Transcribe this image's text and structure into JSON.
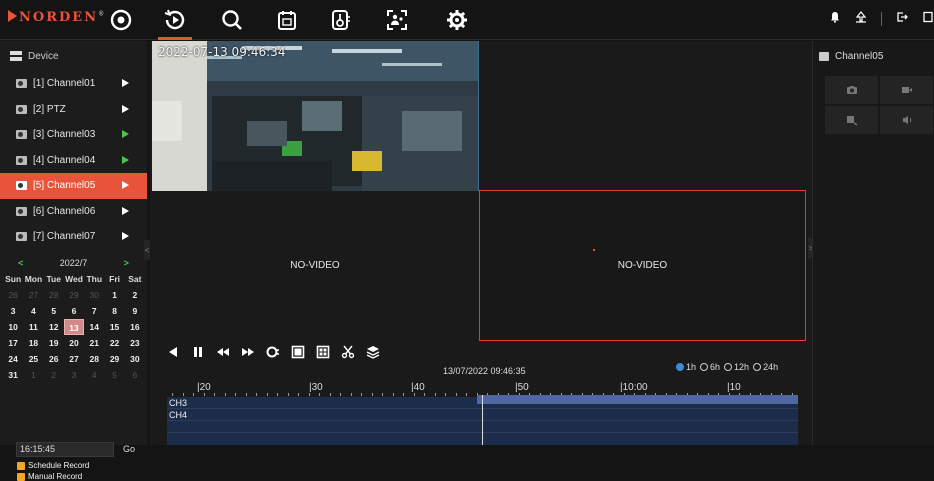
{
  "brand": {
    "name": "NORDEN",
    "reg": "®",
    "accent": "#e8533a"
  },
  "nav": [
    {
      "icon": "live-view-icon"
    },
    {
      "icon": "playback-icon",
      "active": true
    },
    {
      "icon": "search-icon"
    },
    {
      "icon": "calendar-icon"
    },
    {
      "icon": "thermometer-icon"
    },
    {
      "icon": "face-scan-icon"
    },
    {
      "icon": "gear-icon"
    }
  ],
  "device": {
    "title": "Device",
    "channels": [
      {
        "label": "[1] Channel01",
        "play": "white"
      },
      {
        "label": "[2] PTZ",
        "play": "white"
      },
      {
        "label": "[3] Channel03",
        "play": "green"
      },
      {
        "label": "[4] Channel04",
        "play": "green"
      },
      {
        "label": "[5] Channel05",
        "play": "white",
        "selected": true
      },
      {
        "label": "[6] Channel06",
        "play": "white"
      },
      {
        "label": "[7] Channel07",
        "play": "white"
      }
    ]
  },
  "calendar": {
    "prev": "<",
    "next": ">",
    "month": "2022/7",
    "weekdays": [
      "Sun",
      "Mon",
      "Tue",
      "Wed",
      "Thu",
      "Fri",
      "Sat"
    ],
    "weeks": [
      [
        "26",
        "27",
        "28",
        "29",
        "30",
        "1",
        "2"
      ],
      [
        "3",
        "4",
        "5",
        "6",
        "7",
        "8",
        "9"
      ],
      [
        "10",
        "11",
        "12",
        "13",
        "14",
        "15",
        "16"
      ],
      [
        "17",
        "18",
        "19",
        "20",
        "21",
        "22",
        "23"
      ],
      [
        "24",
        "25",
        "26",
        "27",
        "28",
        "29",
        "30"
      ],
      [
        "31",
        "1",
        "2",
        "3",
        "4",
        "5",
        "6"
      ]
    ],
    "today": "13"
  },
  "goto": {
    "time": "16:15:45",
    "button": "Go"
  },
  "legend": [
    {
      "label": "Schedule Record",
      "color": "#f5a623"
    },
    {
      "label": "Manual Record",
      "color": "#f5a623"
    }
  ],
  "video": {
    "timestamp": "2022-07-13 09:46:34",
    "panes": [
      "NO-VIDEO",
      "NO-VIDEO"
    ]
  },
  "playback": {
    "time": "13/07/2022 09:46:35",
    "ranges": [
      {
        "label": "1h",
        "selected": true
      },
      {
        "label": "6h"
      },
      {
        "label": "12h"
      },
      {
        "label": "24h"
      }
    ]
  },
  "timeline": {
    "labels": [
      "|20",
      "|30",
      "|40",
      "|50",
      "|10:00",
      "|10"
    ],
    "rows": [
      "CH3",
      "CH4"
    ]
  },
  "right_panel": {
    "title": "Channel05"
  }
}
